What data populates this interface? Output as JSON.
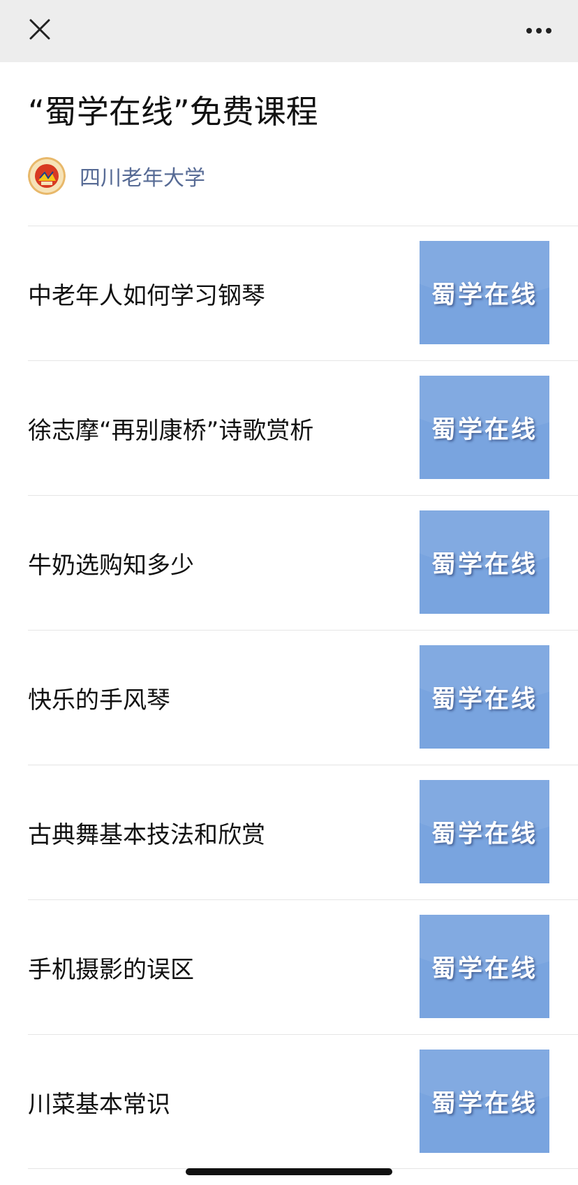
{
  "header": {
    "close_icon": "close-icon",
    "more_icon": "more-horizontal-icon"
  },
  "article": {
    "title": "“蜀学在线”免费课程",
    "author": "四川老年大学",
    "author_avatar_icon": "university-logo-icon"
  },
  "courses": [
    {
      "title": "中老年人如何学习钢琴",
      "thumb_text": "蜀学在线"
    },
    {
      "title": "徐志摩“再别康桥”诗歌赏析",
      "thumb_text": "蜀学在线"
    },
    {
      "title": "牛奶选购知多少",
      "thumb_text": "蜀学在线"
    },
    {
      "title": "快乐的手风琴",
      "thumb_text": "蜀学在线"
    },
    {
      "title": "古典舞基本技法和欣赏",
      "thumb_text": "蜀学在线"
    },
    {
      "title": "手机摄影的误区",
      "thumb_text": "蜀学在线"
    },
    {
      "title": "川菜基本常识",
      "thumb_text": "蜀学在线"
    }
  ],
  "colors": {
    "topbar_bg": "#ededed",
    "author_link": "#576b95",
    "thumb_bg": "#79a4df",
    "divider": "#e5e5e5"
  }
}
